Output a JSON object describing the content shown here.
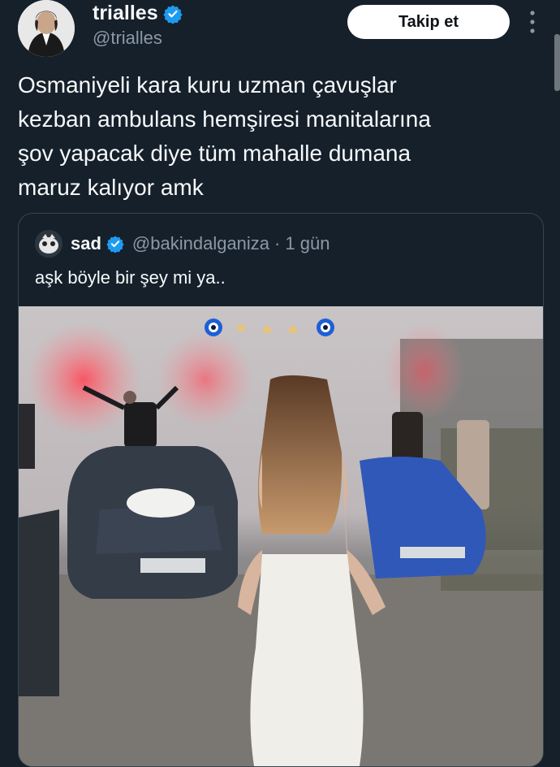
{
  "tweet": {
    "display_name": "trialles",
    "handle": "@trialles",
    "follow_label": "Takip et",
    "text_lines": [
      "Osmaniyeli kara kuru uzman çavuşlar",
      "kezban ambulans hemşiresi manitalarına",
      "şov yapacak diye tüm mahalle dumana",
      "maruz kalıyor amk"
    ]
  },
  "quote": {
    "display_name": "sad",
    "handle": "@bakindalganiza",
    "separator": "·",
    "time": "1 gün",
    "text": "aşk böyle bir şey mi ya.."
  },
  "colors": {
    "background": "#15202b",
    "verified": "#1d9bf0",
    "secondary_text": "#8b98a5",
    "border": "#38444d"
  },
  "icons": {
    "verified": "verified-badge-icon",
    "more": "more-vertical-icon"
  }
}
